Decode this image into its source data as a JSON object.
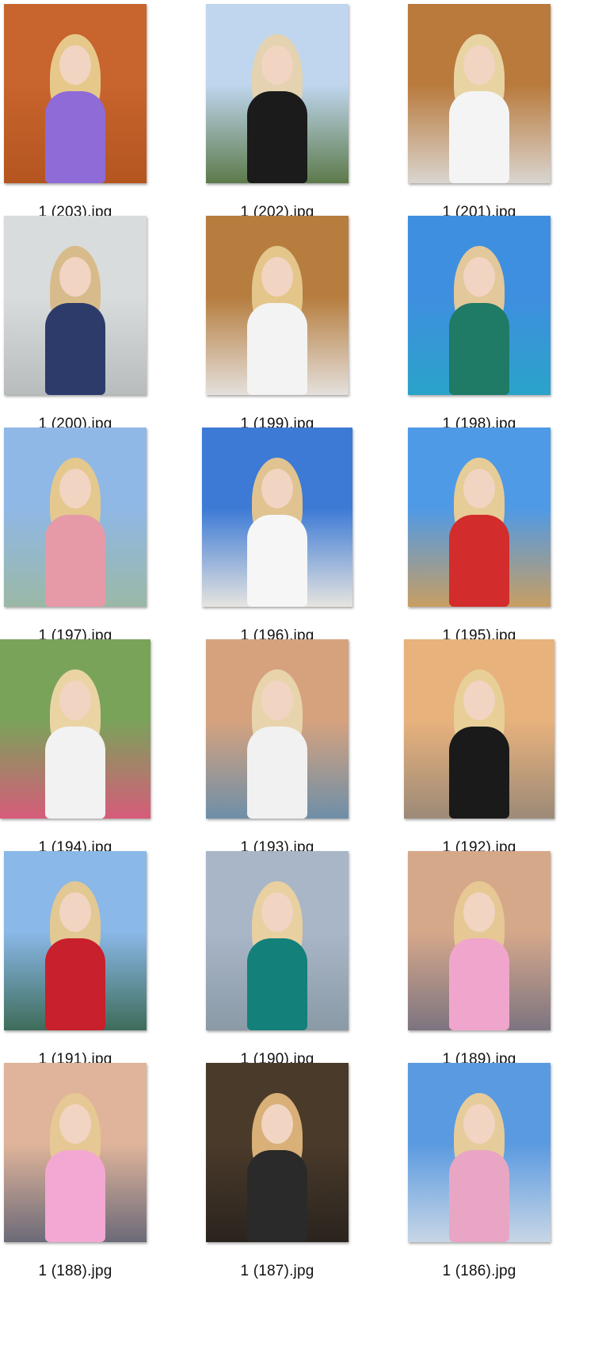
{
  "files": [
    {
      "name": "1 (203).jpg",
      "bg": [
        "#c8642e",
        "#b4551f"
      ],
      "accent": "#8f6bd8",
      "hair": "#e6c98a",
      "shape": "portrait"
    },
    {
      "name": "1 (202).jpg",
      "bg": [
        "#bfd6ee",
        "#5c7a4a"
      ],
      "accent": "#1b1b1b",
      "hair": "#e4d2b0",
      "shape": "portrait"
    },
    {
      "name": "1 (201).jpg",
      "bg": [
        "#b97a3c",
        "#d9d5cf"
      ],
      "accent": "#f4f4f4",
      "hair": "#e8d3a3",
      "shape": "portrait"
    },
    {
      "name": "1 (200).jpg",
      "bg": [
        "#d9dcdc",
        "#b8bcbc"
      ],
      "accent": "#2d3b6b",
      "hair": "#d8bb8a",
      "shape": "portrait"
    },
    {
      "name": "1 (199).jpg",
      "bg": [
        "#b67d3e",
        "#e4e0dc"
      ],
      "accent": "#f3f3f3",
      "hair": "#e4c68a",
      "shape": "portrait"
    },
    {
      "name": "1 (198).jpg",
      "bg": [
        "#3f8fe0",
        "#2aa3c8"
      ],
      "accent": "#1f7a66",
      "hair": "#e2c89a",
      "shape": "portrait"
    },
    {
      "name": "1 (197).jpg",
      "bg": [
        "#8fb8e6",
        "#9bb8a6"
      ],
      "accent": "#e69aa8",
      "hair": "#e4c88e",
      "shape": "portrait"
    },
    {
      "name": "1 (196).jpg",
      "bg": [
        "#3c7ad6",
        "#e6e4df"
      ],
      "accent": "#f6f6f6",
      "hair": "#e0c390",
      "shape": "portrait"
    },
    {
      "name": "1 (195).jpg",
      "bg": [
        "#4f9ae6",
        "#c89e63"
      ],
      "accent": "#d22c2c",
      "hair": "#e6cc96",
      "shape": "portrait"
    },
    {
      "name": "1 (194).jpg",
      "bg": [
        "#7aa35a",
        "#d65c7a"
      ],
      "accent": "#f2f2f2",
      "hair": "#ead4a4",
      "shape": "portrait"
    },
    {
      "name": "1 (193).jpg",
      "bg": [
        "#d6a27e",
        "#6e8fa8"
      ],
      "accent": "#f1f1f1",
      "hair": "#e8d4ac",
      "shape": "portrait"
    },
    {
      "name": "1 (192).jpg",
      "bg": [
        "#e8b27c",
        "#9c8a78"
      ],
      "accent": "#1a1a1a",
      "hair": "#e8cf98",
      "shape": "portrait"
    },
    {
      "name": "1 (191).jpg",
      "bg": [
        "#8ab8e8",
        "#3e6c5a"
      ],
      "accent": "#c8202c",
      "hair": "#e2c892",
      "shape": "portrait"
    },
    {
      "name": "1 (190).jpg",
      "bg": [
        "#a9b6c8",
        "#8a9aa6"
      ],
      "accent": "#14807a",
      "hair": "#e8d0a0",
      "shape": "portrait"
    },
    {
      "name": "1 (189).jpg",
      "bg": [
        "#d6a88a",
        "#7d7480"
      ],
      "accent": "#f0a6cc",
      "hair": "#e6c894",
      "shape": "portrait"
    },
    {
      "name": "1 (188).jpg",
      "bg": [
        "#e0b49a",
        "#6c6a78"
      ],
      "accent": "#f2a8d2",
      "hair": "#e6c894",
      "shape": "portrait"
    },
    {
      "name": "1 (187).jpg",
      "bg": [
        "#4a3a2a",
        "#2a241e"
      ],
      "accent": "#2a2a2a",
      "hair": "#d8b078",
      "shape": "portrait"
    },
    {
      "name": "1 (186).jpg",
      "bg": [
        "#5a9ae0",
        "#c8d6e6"
      ],
      "accent": "#e8a6c4",
      "hair": "#e6cc9a",
      "shape": "portrait"
    }
  ],
  "icons": {
    "thumbnail": "photo-thumbnail"
  }
}
